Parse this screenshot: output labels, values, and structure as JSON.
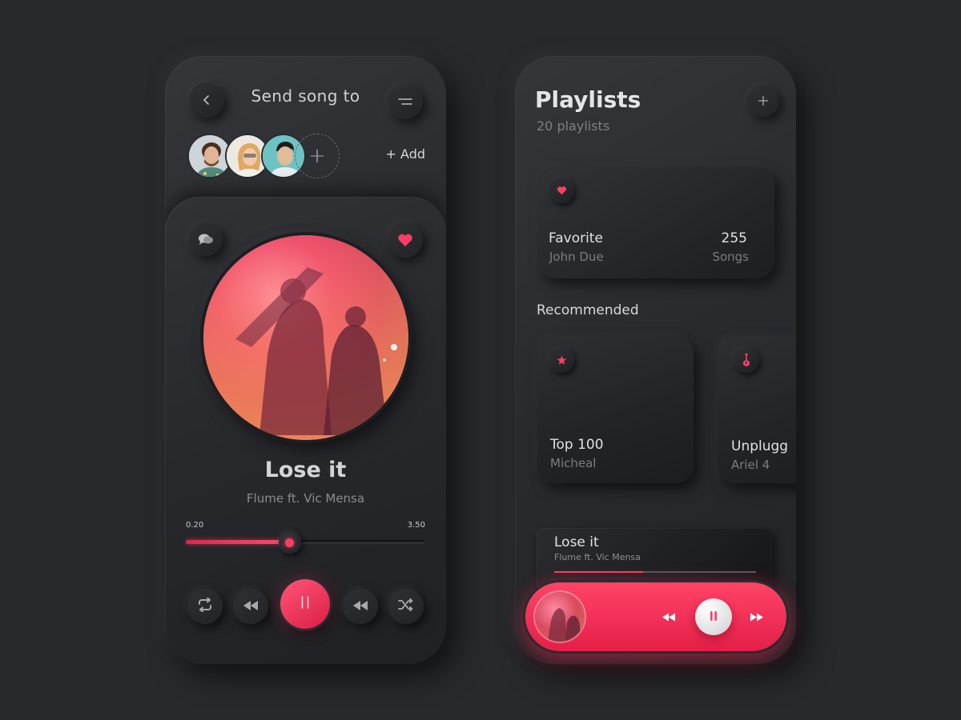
{
  "send_screen": {
    "title": "Send song to",
    "add_label": "+ Add",
    "add_avatar_glyph": "+",
    "icons": {
      "back": "chevron-left-icon",
      "menu": "menu-lines-icon",
      "chat": "chat-bubbles-icon",
      "like": "heart-icon"
    },
    "recipients": [
      {
        "name": "avatar-1"
      },
      {
        "name": "avatar-2"
      },
      {
        "name": "avatar-3"
      }
    ]
  },
  "now_playing": {
    "title": "Lose it",
    "artist": "Flume ft. Vic Mensa",
    "elapsed": "0.20",
    "duration": "3.50",
    "progress_fraction": 0.435,
    "controls": [
      "repeat-icon",
      "rewind-icon",
      "pause-icon",
      "rewind-icon",
      "shuffle-icon"
    ]
  },
  "playlists_screen": {
    "title": "Playlists",
    "count_label": "20 playlists",
    "add_icon": "plus-icon",
    "favorite": {
      "name": "Favorite",
      "owner": "John Due",
      "count": "255",
      "count_unit": "Songs",
      "icon": "heart-icon"
    },
    "section_label": "Recommended",
    "recommended": [
      {
        "name": "Top 100",
        "owner": "Micheal",
        "icon": "star-icon"
      },
      {
        "name": "Unplugg",
        "owner": "Ariel 4",
        "icon": "guitar-icon"
      }
    ]
  },
  "mini_player": {
    "title": "Lose it",
    "artist": "Flume ft. Vic Mensa",
    "progress_fraction": 0.44,
    "controls": [
      "rewind-icon",
      "pause-icon",
      "fast-forward-icon"
    ]
  },
  "colors": {
    "background": "#28292c",
    "accent": "#ff3d62",
    "accent_dark": "#e41f48",
    "text_primary": "#e4e5e8",
    "text_secondary": "#7d7f84"
  }
}
